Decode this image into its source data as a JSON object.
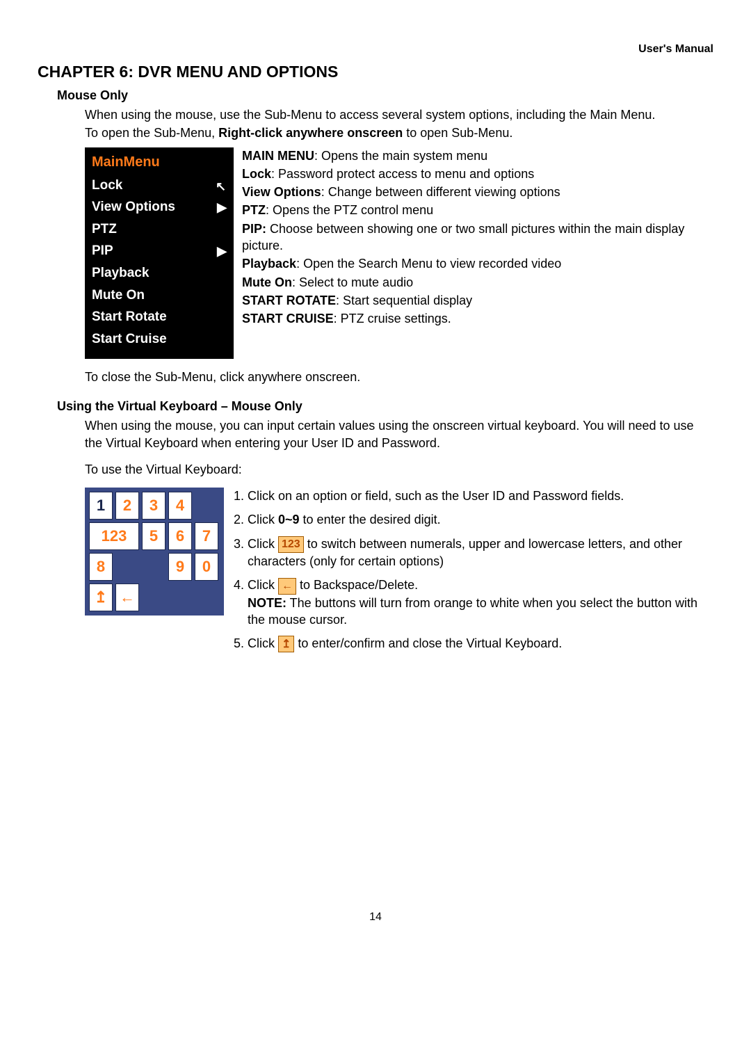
{
  "header_right": "User's Manual",
  "chapter_title": "CHAPTER 6: DVR MENU AND OPTIONS",
  "mouse_only_title": "Mouse Only",
  "p1": "When using the mouse, use the Sub-Menu to access several system options, including the Main Menu.",
  "p2_pre": "To open the Sub-Menu, ",
  "p2_bold": "Right-click anywhere onscreen",
  "p2_post": " to open Sub-Menu.",
  "submenu": {
    "main": "MainMenu",
    "items": [
      "Lock",
      "View Options",
      "PTZ",
      "PIP",
      "Playback",
      "Mute On",
      "Start Rotate",
      "Start Cruise"
    ]
  },
  "desc": {
    "l1b": "MAIN MENU",
    "l1": ": Opens the main system menu",
    "l2b": "Lock",
    "l2": ": Password protect access to menu and options",
    "l3b": "View Options",
    "l3": ": Change between different viewing options",
    "l4b": "PTZ",
    "l4": ": Opens the PTZ control menu",
    "l5b": "PIP:",
    "l5": " Choose between showing one or two small pictures within the main display picture.",
    "l6b": "Playback",
    "l6": ": Open the Search Menu to view recorded video",
    "l7b": "Mute On",
    "l7": ": Select to mute audio",
    "l8b": "START ROTATE",
    "l8": ": Start sequential display",
    "l9b": "START CRUISE",
    "l9": ": PTZ cruise settings."
  },
  "p3": "To close the Sub-Menu, click anywhere onscreen.",
  "vk_title": "Using the Virtual Keyboard – Mouse Only",
  "vk_p1": "When using the mouse, you can input certain values using the onscreen virtual keyboard. You will need to use the Virtual Keyboard when entering your User ID and Password.",
  "vk_p2": "To use the Virtual Keyboard:",
  "keys": {
    "k1": "1",
    "k2": "2",
    "k3": "3",
    "k4": "4",
    "k123": "123",
    "k5": "5",
    "k6": "6",
    "k7": "7",
    "k8": "8",
    "k9": "9",
    "k0": "0",
    "enter": "↥",
    "back": "←"
  },
  "steps": {
    "s1": "Click on an option or field, such as the User ID and Password fields.",
    "s2_pre": "Click ",
    "s2_bold": "0~9",
    "s2_post": " to enter the desired digit.",
    "s3_pre": "Click ",
    "s3_icon": "123",
    "s3_post": "to switch between numerals, upper and lowercase letters, and other characters (only for certain options)",
    "s4_pre": "Click ",
    "s4_icon": "←",
    "s4_mid": " to Backspace/Delete.",
    "s4_note_b": "NOTE:",
    "s4_note": " The buttons will turn from orange to white when you select the button with the mouse cursor.",
    "s5_pre": "Click ",
    "s5_icon": "↥",
    "s5_post": "to enter/confirm and close the Virtual Keyboard."
  },
  "page_number": "14"
}
